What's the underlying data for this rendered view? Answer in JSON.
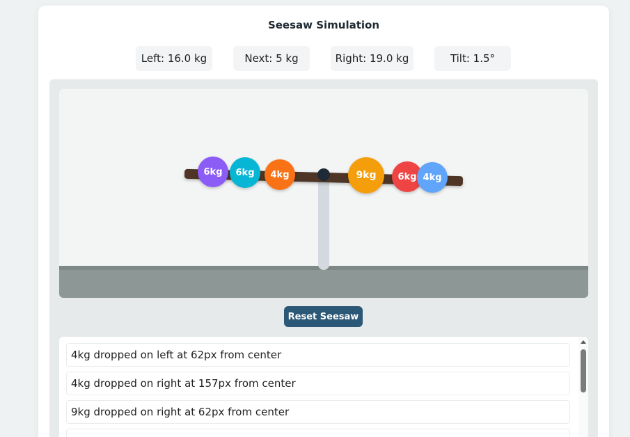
{
  "title": "Seesaw Simulation",
  "stats": {
    "left": "Left: 16.0 kg",
    "next": "Next: 5 kg",
    "right": "Right: 19.0 kg",
    "tilt": "Tilt: 1.5°"
  },
  "tilt_degrees": 1.5,
  "weights": [
    {
      "label": "6kg",
      "side": "left",
      "color": "#8b5cf6"
    },
    {
      "label": "6kg",
      "side": "left",
      "color": "#06b6d4"
    },
    {
      "label": "4kg",
      "side": "left",
      "color": "#f97316"
    },
    {
      "label": "9kg",
      "side": "right",
      "color": "#f59e0b"
    },
    {
      "label": "6kg",
      "side": "right",
      "color": "#ef4444"
    },
    {
      "label": "4kg",
      "side": "right",
      "color": "#60a5fa"
    }
  ],
  "reset_label": "Reset Seesaw",
  "log": [
    "4kg dropped on left at 62px from center",
    "4kg dropped on right at 157px from center",
    "9kg dropped on right at 62px from center"
  ],
  "colors": {
    "button": "#2b5876",
    "beam": "#4e3526",
    "ground": "#8c9796"
  }
}
